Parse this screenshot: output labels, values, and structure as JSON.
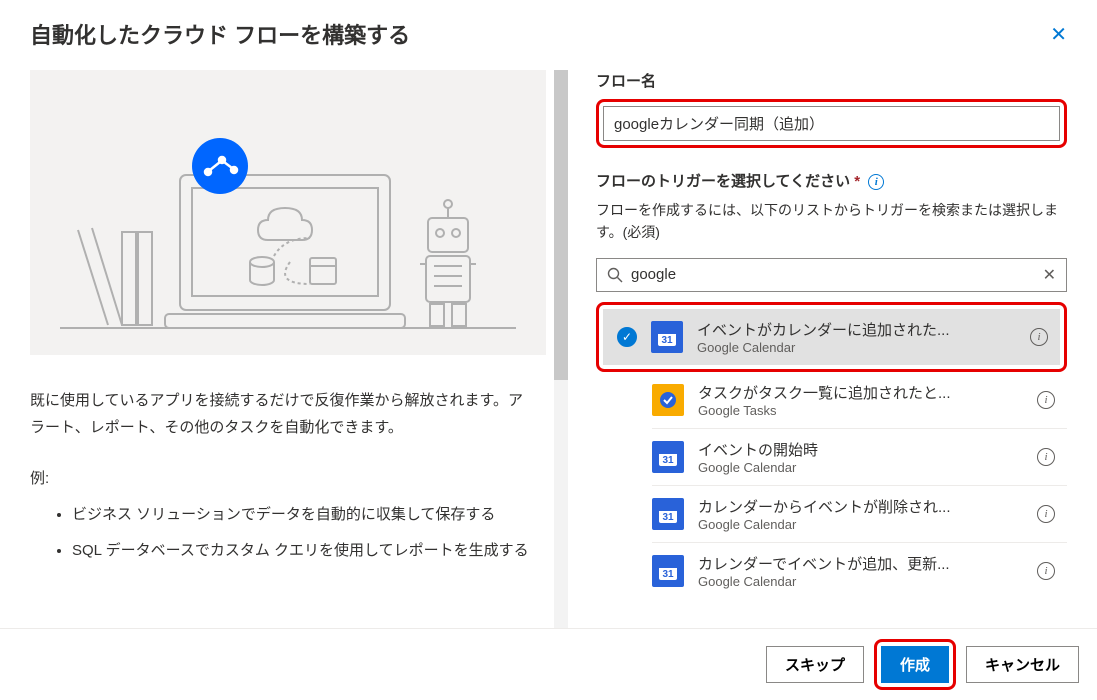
{
  "header": {
    "title": "自動化したクラウド フローを構築する"
  },
  "left": {
    "description": "既に使用しているアプリを接続するだけで反復作業から解放されます。アラート、レポート、その他のタスクを自動化できます。",
    "examples_label": "例:",
    "examples": [
      "ビジネス ソリューションでデータを自動的に収集して保存する",
      "SQL データベースでカスタム クエリを使用してレポートを生成する"
    ]
  },
  "right": {
    "flow_name_label": "フロー名",
    "flow_name_value": "googleカレンダー同期（追加）",
    "trigger_label": "フローのトリガーを選択してください",
    "trigger_desc": "フローを作成するには、以下のリストからトリガーを検索または選択します。(必須)",
    "search_value": "google",
    "triggers": [
      {
        "title": "イベントがカレンダーに追加された...",
        "sub": "Google Calendar",
        "icon": "gcal",
        "selected": true
      },
      {
        "title": "タスクがタスク一覧に追加されたと...",
        "sub": "Google Tasks",
        "icon": "gtasks",
        "selected": false
      },
      {
        "title": "イベントの開始時",
        "sub": "Google Calendar",
        "icon": "gcal",
        "selected": false
      },
      {
        "title": "カレンダーからイベントが削除され...",
        "sub": "Google Calendar",
        "icon": "gcal",
        "selected": false
      },
      {
        "title": "カレンダーでイベントが追加、更新...",
        "sub": "Google Calendar",
        "icon": "gcal",
        "selected": false
      }
    ]
  },
  "footer": {
    "skip": "スキップ",
    "create": "作成",
    "cancel": "キャンセル"
  }
}
